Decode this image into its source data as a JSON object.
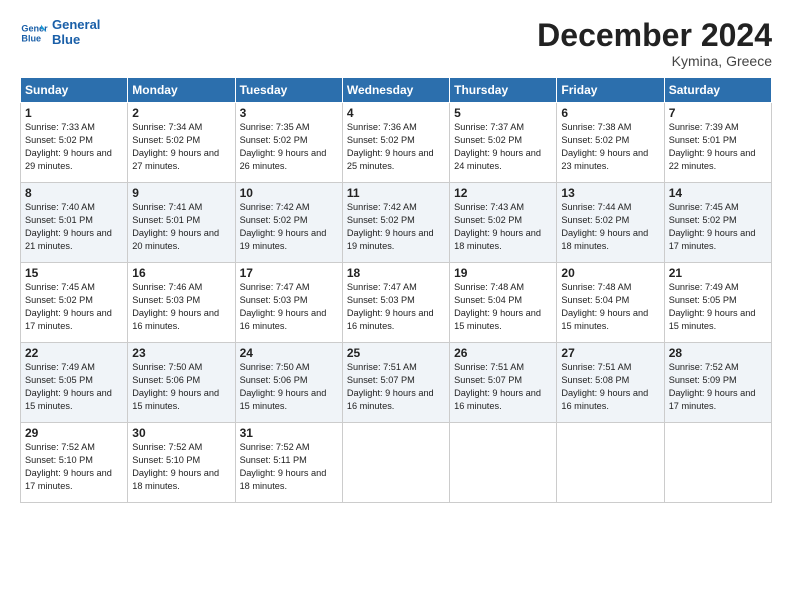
{
  "header": {
    "logo_line1": "General",
    "logo_line2": "Blue",
    "month": "December 2024",
    "location": "Kymina, Greece"
  },
  "days_of_week": [
    "Sunday",
    "Monday",
    "Tuesday",
    "Wednesday",
    "Thursday",
    "Friday",
    "Saturday"
  ],
  "weeks": [
    [
      {
        "day": "1",
        "sunrise": "7:33 AM",
        "sunset": "5:02 PM",
        "daylight": "9 hours and 29 minutes."
      },
      {
        "day": "2",
        "sunrise": "7:34 AM",
        "sunset": "5:02 PM",
        "daylight": "9 hours and 27 minutes."
      },
      {
        "day": "3",
        "sunrise": "7:35 AM",
        "sunset": "5:02 PM",
        "daylight": "9 hours and 26 minutes."
      },
      {
        "day": "4",
        "sunrise": "7:36 AM",
        "sunset": "5:02 PM",
        "daylight": "9 hours and 25 minutes."
      },
      {
        "day": "5",
        "sunrise": "7:37 AM",
        "sunset": "5:02 PM",
        "daylight": "9 hours and 24 minutes."
      },
      {
        "day": "6",
        "sunrise": "7:38 AM",
        "sunset": "5:02 PM",
        "daylight": "9 hours and 23 minutes."
      },
      {
        "day": "7",
        "sunrise": "7:39 AM",
        "sunset": "5:01 PM",
        "daylight": "9 hours and 22 minutes."
      }
    ],
    [
      {
        "day": "8",
        "sunrise": "7:40 AM",
        "sunset": "5:01 PM",
        "daylight": "9 hours and 21 minutes."
      },
      {
        "day": "9",
        "sunrise": "7:41 AM",
        "sunset": "5:01 PM",
        "daylight": "9 hours and 20 minutes."
      },
      {
        "day": "10",
        "sunrise": "7:42 AM",
        "sunset": "5:02 PM",
        "daylight": "9 hours and 19 minutes."
      },
      {
        "day": "11",
        "sunrise": "7:42 AM",
        "sunset": "5:02 PM",
        "daylight": "9 hours and 19 minutes."
      },
      {
        "day": "12",
        "sunrise": "7:43 AM",
        "sunset": "5:02 PM",
        "daylight": "9 hours and 18 minutes."
      },
      {
        "day": "13",
        "sunrise": "7:44 AM",
        "sunset": "5:02 PM",
        "daylight": "9 hours and 18 minutes."
      },
      {
        "day": "14",
        "sunrise": "7:45 AM",
        "sunset": "5:02 PM",
        "daylight": "9 hours and 17 minutes."
      }
    ],
    [
      {
        "day": "15",
        "sunrise": "7:45 AM",
        "sunset": "5:02 PM",
        "daylight": "9 hours and 17 minutes."
      },
      {
        "day": "16",
        "sunrise": "7:46 AM",
        "sunset": "5:03 PM",
        "daylight": "9 hours and 16 minutes."
      },
      {
        "day": "17",
        "sunrise": "7:47 AM",
        "sunset": "5:03 PM",
        "daylight": "9 hours and 16 minutes."
      },
      {
        "day": "18",
        "sunrise": "7:47 AM",
        "sunset": "5:03 PM",
        "daylight": "9 hours and 16 minutes."
      },
      {
        "day": "19",
        "sunrise": "7:48 AM",
        "sunset": "5:04 PM",
        "daylight": "9 hours and 15 minutes."
      },
      {
        "day": "20",
        "sunrise": "7:48 AM",
        "sunset": "5:04 PM",
        "daylight": "9 hours and 15 minutes."
      },
      {
        "day": "21",
        "sunrise": "7:49 AM",
        "sunset": "5:05 PM",
        "daylight": "9 hours and 15 minutes."
      }
    ],
    [
      {
        "day": "22",
        "sunrise": "7:49 AM",
        "sunset": "5:05 PM",
        "daylight": "9 hours and 15 minutes."
      },
      {
        "day": "23",
        "sunrise": "7:50 AM",
        "sunset": "5:06 PM",
        "daylight": "9 hours and 15 minutes."
      },
      {
        "day": "24",
        "sunrise": "7:50 AM",
        "sunset": "5:06 PM",
        "daylight": "9 hours and 15 minutes."
      },
      {
        "day": "25",
        "sunrise": "7:51 AM",
        "sunset": "5:07 PM",
        "daylight": "9 hours and 16 minutes."
      },
      {
        "day": "26",
        "sunrise": "7:51 AM",
        "sunset": "5:07 PM",
        "daylight": "9 hours and 16 minutes."
      },
      {
        "day": "27",
        "sunrise": "7:51 AM",
        "sunset": "5:08 PM",
        "daylight": "9 hours and 16 minutes."
      },
      {
        "day": "28",
        "sunrise": "7:52 AM",
        "sunset": "5:09 PM",
        "daylight": "9 hours and 17 minutes."
      }
    ],
    [
      {
        "day": "29",
        "sunrise": "7:52 AM",
        "sunset": "5:10 PM",
        "daylight": "9 hours and 17 minutes."
      },
      {
        "day": "30",
        "sunrise": "7:52 AM",
        "sunset": "5:10 PM",
        "daylight": "9 hours and 18 minutes."
      },
      {
        "day": "31",
        "sunrise": "7:52 AM",
        "sunset": "5:11 PM",
        "daylight": "9 hours and 18 minutes."
      },
      {
        "day": "",
        "sunrise": "",
        "sunset": "",
        "daylight": ""
      },
      {
        "day": "",
        "sunrise": "",
        "sunset": "",
        "daylight": ""
      },
      {
        "day": "",
        "sunrise": "",
        "sunset": "",
        "daylight": ""
      },
      {
        "day": "",
        "sunrise": "",
        "sunset": "",
        "daylight": ""
      }
    ]
  ]
}
